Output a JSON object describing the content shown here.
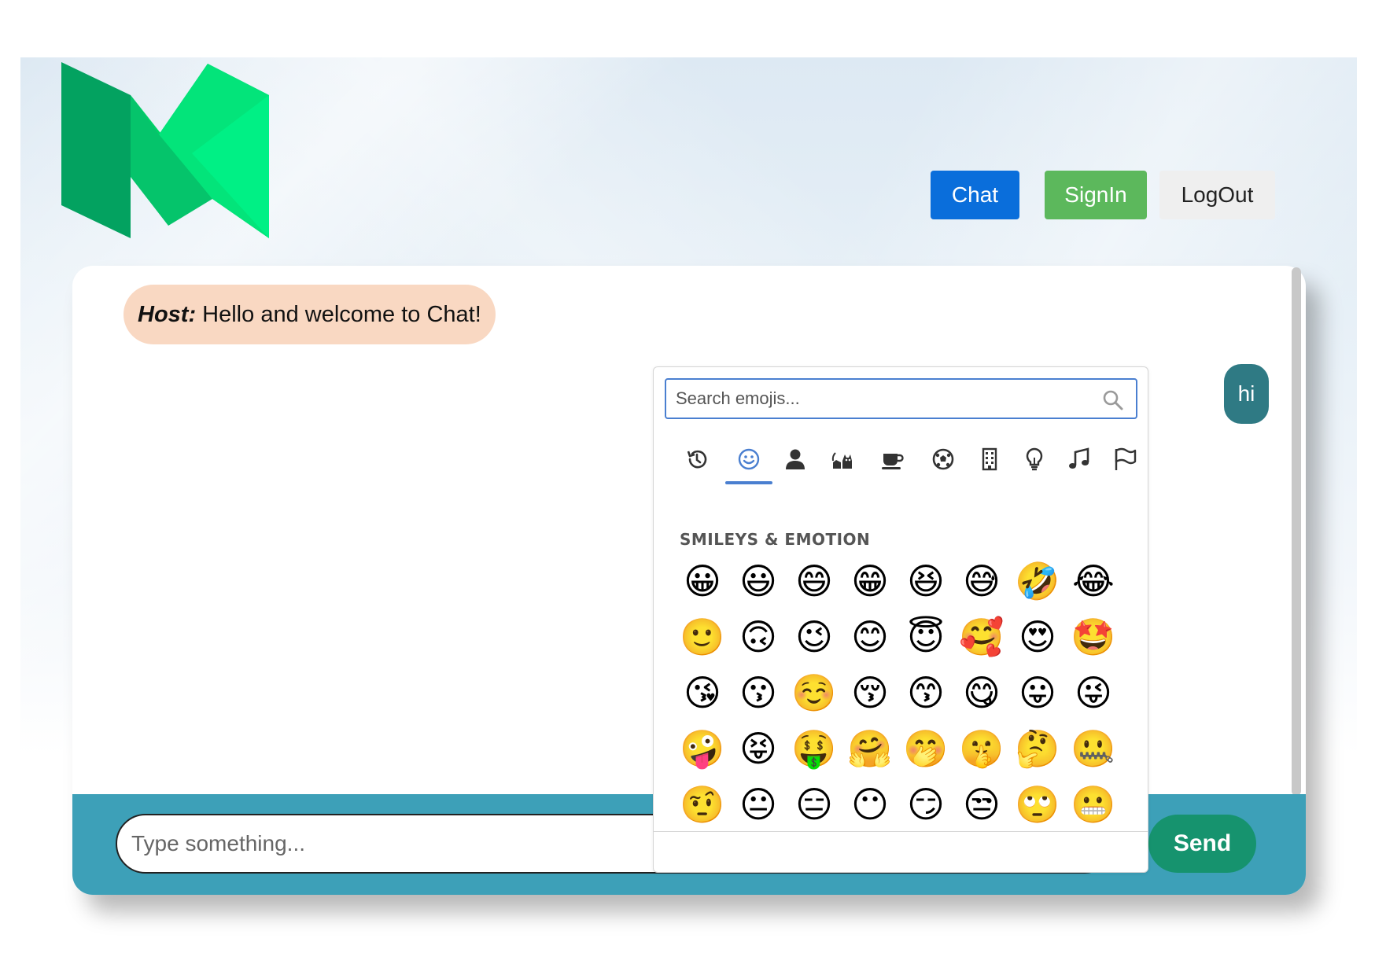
{
  "nav": {
    "chat_label": "Chat",
    "signin_label": "SignIn",
    "logout_label": "LogOut"
  },
  "messages": {
    "host_name": "Host:",
    "host_text": "Hello and welcome to Chat!",
    "user_text": "hi"
  },
  "composer": {
    "placeholder": "Type something...",
    "send_label": "Send"
  },
  "emoji_picker": {
    "search_placeholder": "Search emojis...",
    "categories": [
      "recent",
      "smileys",
      "people",
      "animals",
      "food",
      "activities",
      "travel",
      "objects",
      "symbols",
      "flags"
    ],
    "active_category": "smileys",
    "section_title": "SMILEYS & EMOTION",
    "emojis": [
      "😀",
      "😃",
      "😄",
      "😁",
      "😆",
      "😅",
      "🤣",
      "😂",
      "🙂",
      "🙃",
      "😉",
      "😊",
      "😇",
      "🥰",
      "😍",
      "🤩",
      "😘",
      "😗",
      "☺️",
      "😚",
      "😙",
      "😋",
      "😛",
      "😜",
      "🤪",
      "😝",
      "🤑",
      "🤗",
      "🤭",
      "🤫",
      "🤔",
      "🤐",
      "🤨",
      "😐",
      "😑",
      "😶",
      "😏",
      "😒",
      "🙄",
      "😬"
    ]
  },
  "colors": {
    "chat_button": "#0a6edb",
    "signin_button": "#5cb85c",
    "logout_button": "#efefef",
    "host_bubble": "#f9d8c2",
    "user_bubble": "#2f7a84",
    "input_bar": "#3da0b8",
    "send_button": "#16936e",
    "picker_accent": "#4a7fd0"
  }
}
